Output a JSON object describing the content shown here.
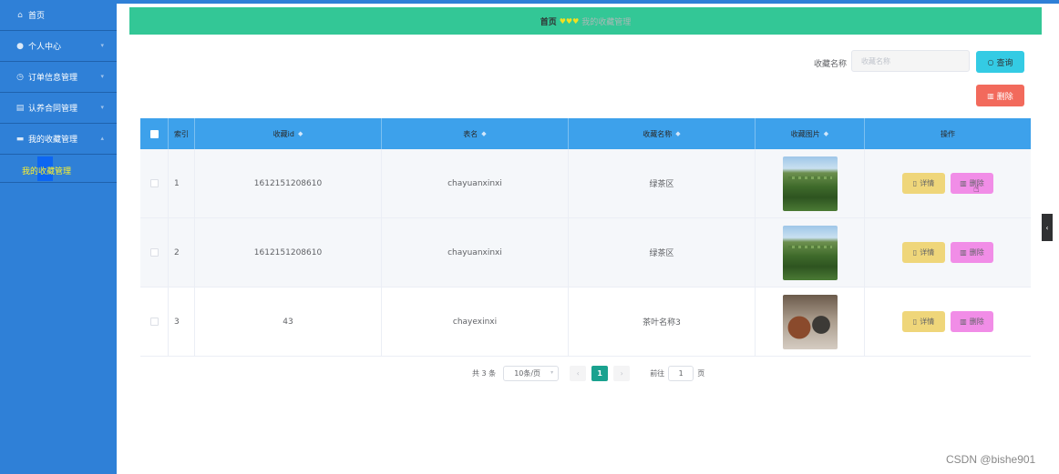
{
  "sidebar": {
    "items": [
      {
        "label": "首页",
        "icon": "home-icon"
      },
      {
        "label": "个人中心",
        "icon": "user-icon"
      },
      {
        "label": "订单信息管理",
        "icon": "clock-icon"
      },
      {
        "label": "认养合同管理",
        "icon": "document-icon"
      },
      {
        "label": "我的收藏管理",
        "icon": "folder-icon"
      }
    ],
    "submenu": {
      "label": "我的收藏管理"
    }
  },
  "breadcrumb": {
    "home": "首页",
    "separator": "♥♥♥",
    "current": "我的收藏管理"
  },
  "search": {
    "label": "收藏名称",
    "placeholder": "收藏名称",
    "value": ""
  },
  "buttons": {
    "query": "查询",
    "delete": "删除",
    "detail": "详情",
    "row_delete": "删除"
  },
  "table": {
    "columns": [
      "索引",
      "收藏id",
      "表名",
      "收藏名称",
      "收藏图片",
      "操作"
    ],
    "rows": [
      {
        "index": "1",
        "id": "1612151208610",
        "table": "chayuanxinxi",
        "name": "绿茶区",
        "image": "tea-plantation"
      },
      {
        "index": "2",
        "id": "1612151208610",
        "table": "chayuanxinxi",
        "name": "绿茶区",
        "image": "tea-plantation"
      },
      {
        "index": "3",
        "id": "43",
        "table": "chayexinxi",
        "name": "茶叶名称3",
        "image": "tea-pot"
      }
    ]
  },
  "pagination": {
    "total": "共 3 条",
    "page_size": "10条/页",
    "current": "1",
    "goto_label": "前往",
    "goto_value": "1",
    "page_suffix": "页"
  },
  "watermark": "CSDN @bishe901",
  "colors": {
    "sidebar": "#2f80d7",
    "breadcrumb": "#33c796",
    "table_header": "#3da1eb",
    "query": "#34cbe4",
    "delete": "#f26a5c"
  }
}
